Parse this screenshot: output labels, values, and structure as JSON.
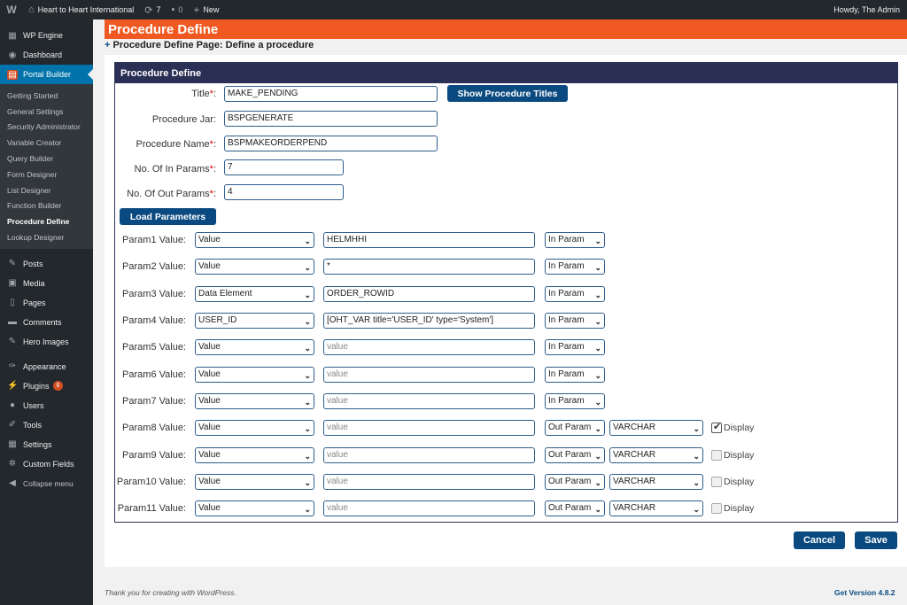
{
  "adminbar": {
    "site_name": "Heart to Heart International",
    "updates_count": "7",
    "comments_count": "0",
    "new_label": "New",
    "greeting": "Howdy, The Admin"
  },
  "sidebar": {
    "top_items": [
      {
        "label": "WP Engine",
        "icon": "wp-engine-icon"
      },
      {
        "label": "Dashboard",
        "icon": "dashboard-icon"
      },
      {
        "label": "Portal Builder",
        "icon": "portal-builder-icon"
      }
    ],
    "submenu": [
      "Getting Started",
      "General Settings",
      "Security Administrator",
      "Variable Creator",
      "Query Builder",
      "Form Designer",
      "List Designer",
      "Function Builder",
      "Procedure Define",
      "Lookup Designer"
    ],
    "active_submenu": "Procedure Define",
    "bottom_items": [
      {
        "label": "Posts",
        "icon": "pin-icon"
      },
      {
        "label": "Media",
        "icon": "media-icon"
      },
      {
        "label": "Pages",
        "icon": "pages-icon"
      },
      {
        "label": "Comments",
        "icon": "comments-icon"
      },
      {
        "label": "Hero Images",
        "icon": "pin-icon"
      },
      {
        "label": "Appearance",
        "icon": "appearance-icon"
      },
      {
        "label": "Plugins",
        "icon": "plugins-icon",
        "badge": "6"
      },
      {
        "label": "Users",
        "icon": "users-icon"
      },
      {
        "label": "Tools",
        "icon": "tools-icon"
      },
      {
        "label": "Settings",
        "icon": "settings-icon"
      },
      {
        "label": "Custom Fields",
        "icon": "custom-fields-icon"
      },
      {
        "label": "Collapse menu",
        "icon": "collapse-icon"
      }
    ]
  },
  "page": {
    "title": "Procedure Define",
    "subtitle": "Procedure Define Page: Define a procedure",
    "subtitle_prefix": "+",
    "panel_title": "Procedure Define"
  },
  "form": {
    "title_label": "Title",
    "title_value": "MAKE_PENDING",
    "show_titles_button": "Show Procedure Titles",
    "jar_label": "Procedure Jar:",
    "jar_value": "BSPGENERATE",
    "name_label": "Procedure Name",
    "name_value": "BSPMAKEORDERPEND",
    "in_params_label": "No. Of In Params",
    "in_params_value": "7",
    "out_params_label": "No. Of Out Params",
    "out_params_value": "4",
    "required_mark": "*",
    "colon": ":",
    "load_button": "Load Parameters"
  },
  "params": [
    {
      "label": "Param1 Value:",
      "type": "Value",
      "value": "HELMHHI",
      "direction": "In Param"
    },
    {
      "label": "Param2 Value:",
      "type": "Value",
      "value": "*",
      "direction": "In Param"
    },
    {
      "label": "Param3 Value:",
      "type": "Data Element",
      "value": "ORDER_ROWID",
      "direction": "In Param"
    },
    {
      "label": "Param4 Value:",
      "type": "USER_ID",
      "value": "[OHT_VAR title='USER_ID' type='System']",
      "direction": "In Param"
    },
    {
      "label": "Param5 Value:",
      "type": "Value",
      "value": "",
      "placeholder": "value",
      "direction": "In Param"
    },
    {
      "label": "Param6 Value:",
      "type": "Value",
      "value": "",
      "placeholder": "value",
      "direction": "In Param"
    },
    {
      "label": "Param7 Value:",
      "type": "Value",
      "value": "",
      "placeholder": "value",
      "direction": "In Param"
    },
    {
      "label": "Param8 Value:",
      "type": "Value",
      "value": "",
      "placeholder": "value",
      "direction": "Out Param",
      "datatype": "VARCHAR",
      "display": true,
      "display_label": "Display"
    },
    {
      "label": "Param9 Value:",
      "type": "Value",
      "value": "",
      "placeholder": "value",
      "direction": "Out Param",
      "datatype": "VARCHAR",
      "display": false,
      "display_label": "Display"
    },
    {
      "label": "Param10 Value:",
      "type": "Value",
      "value": "",
      "placeholder": "value",
      "direction": "Out Param",
      "datatype": "VARCHAR",
      "display": false,
      "display_label": "Display"
    },
    {
      "label": "Param11 Value:",
      "type": "Value",
      "value": "",
      "placeholder": "value",
      "direction": "Out Param",
      "datatype": "VARCHAR",
      "display": false,
      "display_label": "Display"
    }
  ],
  "actions": {
    "cancel": "Cancel",
    "save": "Save"
  },
  "footer": {
    "thanks": "Thank you for creating with WordPress.",
    "version": "Get Version 4.8.2"
  },
  "colors": {
    "header_orange": "#f05a22",
    "panel_navy": "#2a2f55",
    "button_blue": "#0a4a80",
    "wp_active_blue": "#0073aa"
  }
}
